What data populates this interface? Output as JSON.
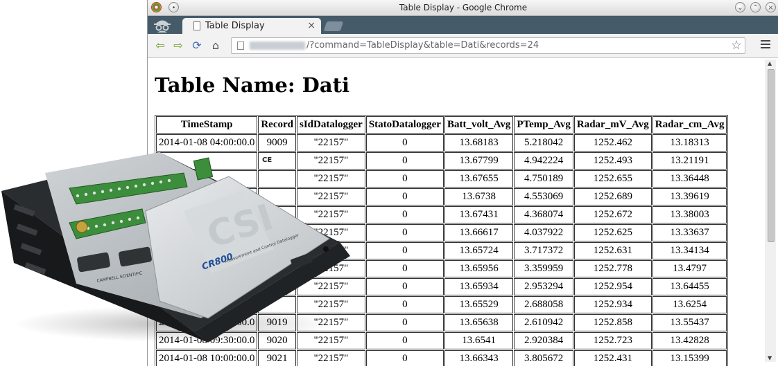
{
  "window": {
    "title": "Table Display - Google Chrome"
  },
  "tab": {
    "label": "Table Display",
    "close": "×"
  },
  "address": {
    "url": "/?command=TableDisplay&table=Dati&records=24"
  },
  "page": {
    "heading": "Table Name: Dati"
  },
  "table": {
    "columns": [
      "TimeStamp",
      "Record",
      "sIdDatalogger",
      "StatoDatalogger",
      "Batt_volt_Avg",
      "PTemp_Avg",
      "Radar_mV_Avg",
      "Radar_cm_Avg"
    ],
    "rows": [
      [
        "2014-01-08 04:00:00.0",
        "9009",
        "\"22157\"",
        "0",
        "13.68183",
        "5.218042",
        "1252.462",
        "13.18313"
      ],
      [
        "",
        "",
        "\"22157\"",
        "0",
        "13.67799",
        "4.942224",
        "1252.493",
        "13.21191"
      ],
      [
        "",
        "",
        "\"22157\"",
        "0",
        "13.67655",
        "4.750189",
        "1252.655",
        "13.36448"
      ],
      [
        "",
        "",
        "\"22157\"",
        "0",
        "13.6738",
        "4.553069",
        "1252.689",
        "13.39619"
      ],
      [
        "",
        "",
        "\"22157\"",
        "0",
        "13.67431",
        "4.368074",
        "1252.672",
        "13.38003"
      ],
      [
        "",
        "",
        "\"22157\"",
        "0",
        "13.66617",
        "4.037922",
        "1252.625",
        "13.33637"
      ],
      [
        "",
        "",
        "\"22157\"",
        "0",
        "13.65724",
        "3.717372",
        "1252.631",
        "13.34134"
      ],
      [
        "",
        "",
        "\"22157\"",
        "0",
        "13.65956",
        "3.359959",
        "1252.778",
        "13.4797"
      ],
      [
        "",
        "",
        "\"22157\"",
        "0",
        "13.65934",
        "2.953294",
        "1252.954",
        "13.64455"
      ],
      [
        "",
        "",
        "\"22157\"",
        "0",
        "13.65529",
        "2.688058",
        "1252.934",
        "13.6254"
      ],
      [
        "2014-01-08 09:00:00.0",
        "9019",
        "\"22157\"",
        "0",
        "13.65638",
        "2.610942",
        "1252.858",
        "13.55437"
      ],
      [
        "2014-01-08 09:30:00.0",
        "9020",
        "\"22157\"",
        "0",
        "13.6541",
        "2.920384",
        "1252.723",
        "13.42828"
      ],
      [
        "2014-01-08 10:00:00.0",
        "9021",
        "\"22157\"",
        "0",
        "13.66343",
        "3.805672",
        "1252.431",
        "13.15399"
      ]
    ]
  },
  "device": {
    "model": "CR800",
    "caption": "Measurement and Control Datalogger",
    "brand": "CAMPBELL SCIENTIFIC",
    "mark": "CE"
  }
}
